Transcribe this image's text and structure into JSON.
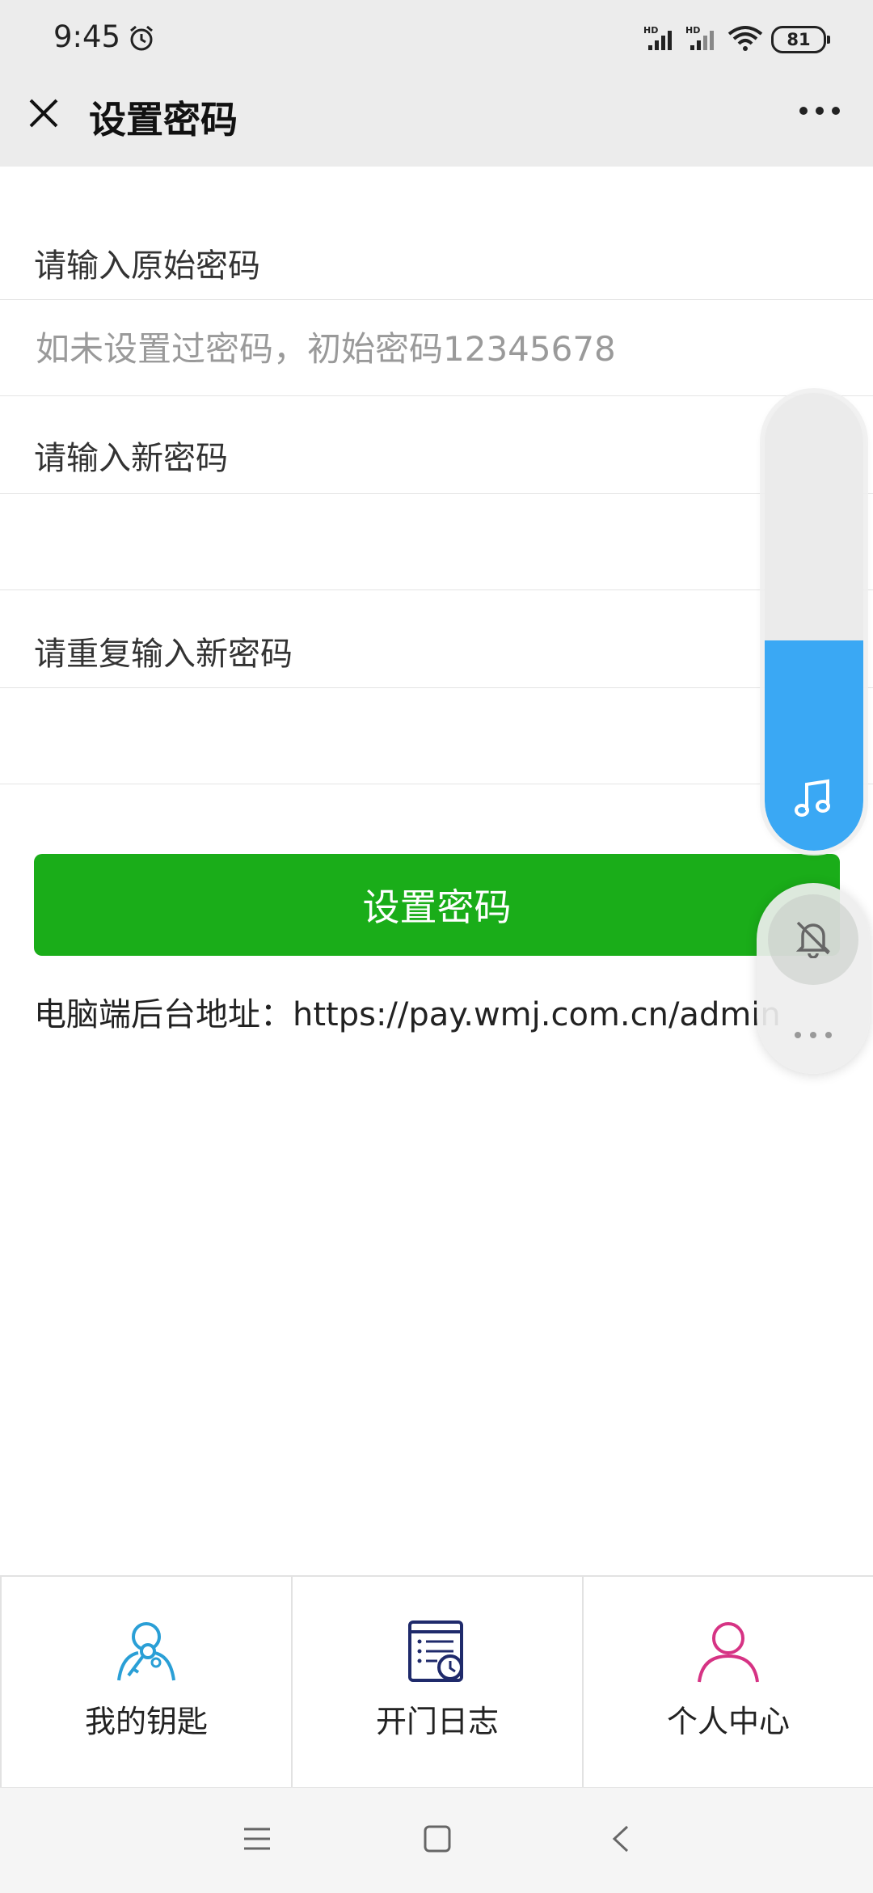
{
  "status_bar": {
    "time": "9:45",
    "battery": "81",
    "signal_badge": "HD"
  },
  "header": {
    "title": "设置密码"
  },
  "form": {
    "old_password": {
      "label": "请输入原始密码",
      "placeholder": "如未设置过密码，初始密码12345678"
    },
    "new_password": {
      "label": "请输入新密码",
      "placeholder": ""
    },
    "repeat_password": {
      "label": "请重复输入新密码",
      "placeholder": ""
    },
    "submit_label": "设置密码",
    "admin_address": "电脑端后台地址：https://pay.wmj.com.cn/admin"
  },
  "volume_overlay": {
    "level_percent": 46
  },
  "tabs": [
    {
      "label": "我的钥匙",
      "icon": "key-user-icon"
    },
    {
      "label": "开门日志",
      "icon": "log-clock-icon"
    },
    {
      "label": "个人中心",
      "icon": "person-icon"
    }
  ],
  "colors": {
    "primary_green": "#1aad19",
    "volume_blue": "#3aa8f4",
    "key_icon": "#2a9fd6",
    "log_icon": "#1f2a6b",
    "person_icon": "#d63384"
  }
}
